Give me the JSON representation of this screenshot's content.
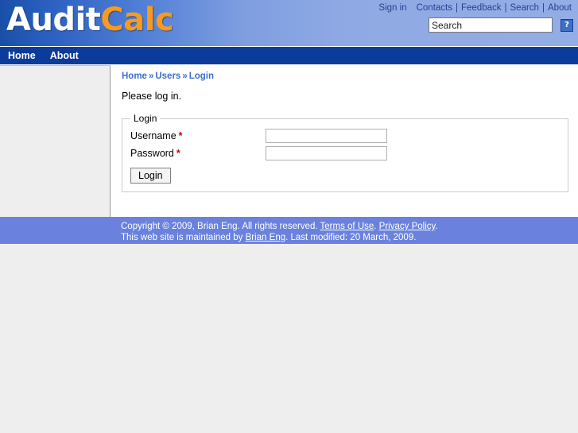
{
  "header": {
    "logo_primary": "Audit",
    "logo_secondary": "Calc",
    "toplinks": [
      {
        "label": "Sign in",
        "sep_after": ""
      },
      {
        "label": "Contacts",
        "sep_after": "|"
      },
      {
        "label": "Feedback",
        "sep_after": "|"
      },
      {
        "label": "Search",
        "sep_after": "|"
      },
      {
        "label": "About",
        "sep_after": ""
      }
    ],
    "separator": "|",
    "search": {
      "value": "Search",
      "placeholder": "Search",
      "help_icon": "question-mark-icon",
      "help_label": "?"
    }
  },
  "nav": {
    "items": [
      {
        "label": "Home"
      },
      {
        "label": "About"
      }
    ]
  },
  "breadcrumb": {
    "separator": "»",
    "items": [
      {
        "label": "Home"
      },
      {
        "label": "Users"
      },
      {
        "label": "Login"
      }
    ]
  },
  "main": {
    "intro": "Please log in.",
    "fieldset_legend": "Login",
    "fields": [
      {
        "label": "Username",
        "required_mark": "*",
        "value": "",
        "placeholder": ""
      },
      {
        "label": "Password",
        "required_mark": "*",
        "value": "",
        "placeholder": ""
      }
    ],
    "submit_label": "Login"
  },
  "footer": {
    "line1_prefix": "Copyright © 2009, Brian Eng. All rights reserved. ",
    "terms_link": "Terms of Use",
    "after_terms": ". ",
    "privacy_link": "Privacy Policy",
    "after_privacy": ".",
    "line2_prefix": "This web site is maintained by ",
    "maintainer_link": "Brian Eng",
    "line2_suffix": ". Last modified: 20 March, 2009."
  },
  "colors": {
    "brand_orange": "#f79a1e",
    "nav_blue": "#0b3c9b",
    "link_blue": "#3a6fd0",
    "footer_blue": "#6a82de",
    "required_red": "#cc0000",
    "page_gray": "#eeeeee"
  }
}
